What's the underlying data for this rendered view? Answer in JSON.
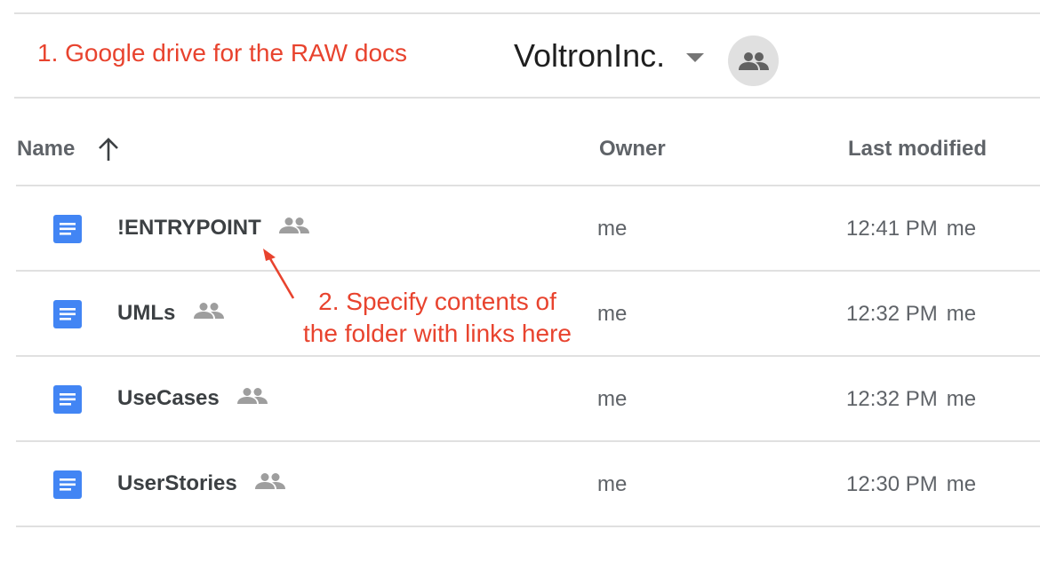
{
  "annotations": {
    "note_1": "1. Google drive for the RAW docs",
    "note_2_line1": "2. Specify contents of",
    "note_2_line2": "the folder with links here"
  },
  "header": {
    "folder_title": "VoltronInc.",
    "dropdown_icon": "caret-down-icon",
    "share_icon": "people-icon"
  },
  "columns": {
    "name": "Name",
    "owner": "Owner",
    "last_modified": "Last modified",
    "sort_icon": "arrow-up-icon"
  },
  "files": [
    {
      "name": "!ENTRYPOINT",
      "owner": "me",
      "time": "12:41 PM",
      "modified_by": "me"
    },
    {
      "name": "UMLs",
      "owner": "me",
      "time": "12:32 PM",
      "modified_by": "me"
    },
    {
      "name": "UseCases",
      "owner": "me",
      "time": "12:32 PM",
      "modified_by": "me"
    },
    {
      "name": "UserStories",
      "owner": "me",
      "time": "12:30 PM",
      "modified_by": "me"
    }
  ],
  "colors": {
    "annotation": "#e8432e",
    "doc_blue": "#4285f4",
    "divider": "#e0e0e0",
    "muted_text": "#5f6368"
  }
}
